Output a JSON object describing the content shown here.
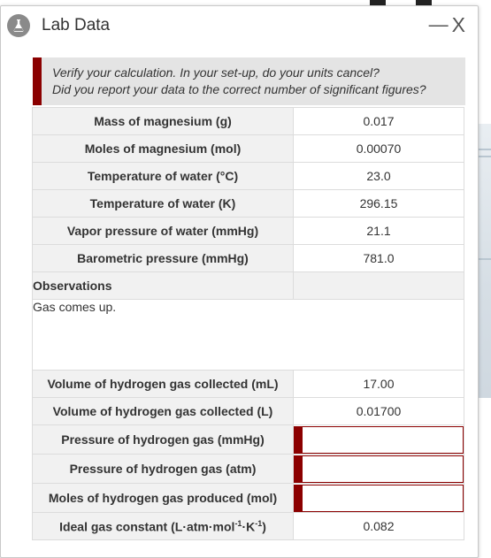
{
  "window": {
    "title": "Lab Data",
    "minimize_label": "—",
    "close_label": "X"
  },
  "notice": {
    "line1": "Verify your calculation. In your set-up, do your units cancel?",
    "line2": "Did you report your data to the correct number of significant figures?"
  },
  "rows_top": [
    {
      "label": "Mass of magnesium (g)",
      "value": "0.017"
    },
    {
      "label": "Moles of magnesium (mol)",
      "value": "0.00070"
    },
    {
      "label": "Temperature of water (°C)",
      "value": "23.0"
    },
    {
      "label": "Temperature of water (K)",
      "value": "296.15"
    },
    {
      "label": "Vapor pressure of water (mmHg)",
      "value": "21.1"
    },
    {
      "label": "Barometric pressure (mmHg)",
      "value": "781.0"
    }
  ],
  "observations": {
    "label": "Observations",
    "text": "Gas comes up."
  },
  "rows_bottom": [
    {
      "label": "Volume of hydrogen gas collected (mL)",
      "value": "17.00"
    },
    {
      "label": "Volume of hydrogen gas collected (L)",
      "value": "0.01700"
    }
  ],
  "inputs": [
    {
      "label": "Pressure of hydrogen gas (mmHg)",
      "value": ""
    },
    {
      "label": "Pressure of hydrogen gas (atm)",
      "value": ""
    },
    {
      "label": "Moles of hydrogen gas produced (mol)",
      "value": ""
    }
  ],
  "gas_constant": {
    "label_prefix": "Ideal gas constant (L·atm·mol",
    "sup1": "-1",
    "label_mid": "·K",
    "sup2": "-1",
    "label_suffix": ")",
    "value": "0.082"
  },
  "colors": {
    "accent": "#8b0000",
    "label_bg": "#f1f1f1",
    "notice_bg": "#e4e4e4"
  },
  "icons": {
    "app": "flask-icon"
  }
}
